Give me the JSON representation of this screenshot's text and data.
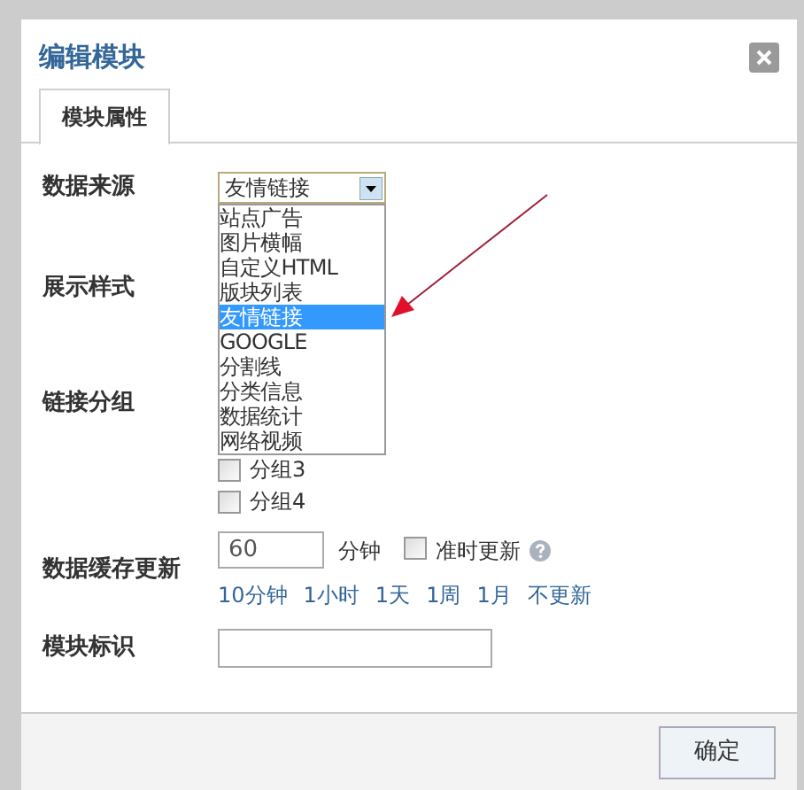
{
  "dialog": {
    "title": "编辑模块",
    "tabs": [
      {
        "label": "模块属性",
        "selected": true
      }
    ],
    "source": {
      "label": "数据来源",
      "value": "友情链接",
      "open": true,
      "options": [
        {
          "label": "站点广告",
          "selected": false
        },
        {
          "label": "图片横幅",
          "selected": false
        },
        {
          "label": "自定义HTML",
          "selected": false
        },
        {
          "label": "版块列表",
          "selected": false
        },
        {
          "label": "友情链接",
          "selected": true
        },
        {
          "label": "GOOGLE",
          "selected": false
        },
        {
          "label": "分割线",
          "selected": false
        },
        {
          "label": "分类信息",
          "selected": false
        },
        {
          "label": "数据统计",
          "selected": false
        },
        {
          "label": "网络视频",
          "selected": false
        }
      ]
    },
    "style": {
      "label": "展示样式"
    },
    "group": {
      "label": "链接分组",
      "checkboxes": [
        {
          "label": "分组3",
          "checked": false
        },
        {
          "label": "分组4",
          "checked": false
        }
      ]
    },
    "cache": {
      "label": "数据缓存更新",
      "value": "60",
      "unit": "分钟",
      "checkbox": {
        "label": "准时更新",
        "checked": false
      },
      "presets": [
        "10分钟",
        "1小时",
        "1天",
        "1周",
        "1月",
        "不更新"
      ]
    },
    "identifier": {
      "label": "模块标识"
    },
    "buttons": [
      "确定"
    ]
  }
}
